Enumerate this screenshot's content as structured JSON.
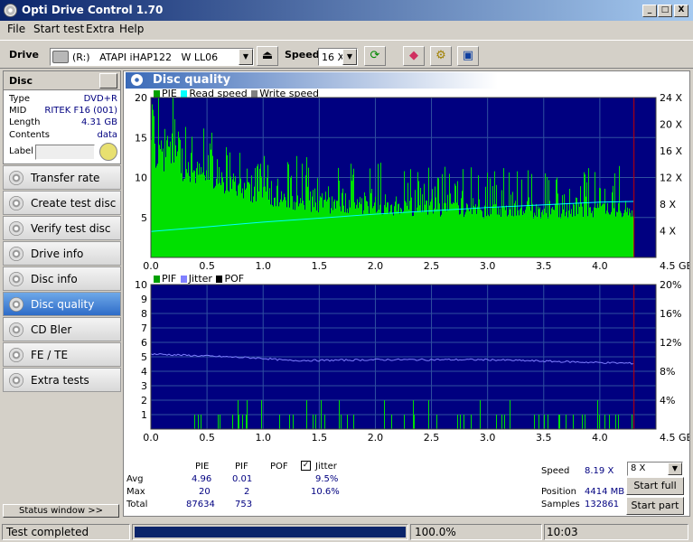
{
  "window": {
    "title": "Opti Drive Control 1.70",
    "btn_min": "_",
    "btn_max": "□",
    "btn_close": "X"
  },
  "menu": {
    "file": "File",
    "start_test": "Start test",
    "extra": "Extra",
    "help": "Help"
  },
  "toolbar": {
    "drive_label": "Drive",
    "drive_value": "(R:)   ATAPI iHAP122   W LL06",
    "speed_label": "Speed",
    "speed_value": "16 X"
  },
  "disc": {
    "header": "Disc",
    "type_k": "Type",
    "type_v": "DVD+R",
    "mid_k": "MID",
    "mid_v": "RITEK F16 (001)",
    "length_k": "Length",
    "length_v": "4.31 GB",
    "contents_k": "Contents",
    "contents_v": "data",
    "label_k": "Label",
    "label_v": ""
  },
  "nav": [
    {
      "label": "Transfer rate"
    },
    {
      "label": "Create test disc"
    },
    {
      "label": "Verify test disc"
    },
    {
      "label": "Drive info"
    },
    {
      "label": "Disc info"
    },
    {
      "label": "Disc quality"
    },
    {
      "label": "CD Bler"
    },
    {
      "label": "FE / TE"
    },
    {
      "label": "Extra tests"
    }
  ],
  "status_window": "Status window >>",
  "main": {
    "title": "Disc quality",
    "legend1": {
      "pie": "PIE",
      "read": "Read speed",
      "write": "Write speed"
    },
    "legend2": {
      "pif": "PIF",
      "jitter": "Jitter",
      "pof": "POF"
    }
  },
  "chart_data": [
    {
      "type": "bar",
      "title": "",
      "series": [
        {
          "name": "PIE",
          "color": "#00e000",
          "baseline_values": [
            15,
            11,
            8.5,
            7.4,
            7,
            6.8,
            6.5,
            6.5,
            6.5,
            6.5
          ],
          "x": [
            0.0,
            0.5,
            1.0,
            1.5,
            2.0,
            2.5,
            3.0,
            3.5,
            4.0,
            4.3
          ],
          "max": 20,
          "avg": 4.96
        },
        {
          "name": "Read speed",
          "color": "#00ffff",
          "x": [
            0.0,
            0.5,
            1.0,
            1.5,
            2.0,
            2.5,
            3.0,
            3.5,
            4.0,
            4.3
          ],
          "values": [
            3.9,
            4.6,
            5.3,
            5.9,
            6.5,
            7.0,
            7.5,
            7.9,
            8.3,
            8.4
          ]
        },
        {
          "name": "Write speed",
          "color": "#808080",
          "values": []
        }
      ],
      "x_ticks": [
        "0.0",
        "0.5",
        "1.0",
        "1.5",
        "2.0",
        "2.5",
        "3.0",
        "3.5",
        "4.0",
        "4.5 GB"
      ],
      "y_left_ticks": [
        "5",
        "10",
        "15",
        "20"
      ],
      "y_right_ticks": [
        "4 X",
        "8 X",
        "12 X",
        "16 X",
        "20 X",
        "24 X"
      ],
      "xlim": [
        0,
        4.5
      ],
      "ylim": [
        0,
        20
      ],
      "y2lim": [
        0,
        24
      ],
      "background": "#000080",
      "grid": true
    },
    {
      "type": "bar",
      "title": "",
      "series": [
        {
          "name": "PIF",
          "color": "#00e000",
          "max": 2,
          "avg": 0.01
        },
        {
          "name": "Jitter",
          "color": "#8080ff",
          "x": [
            0.0,
            0.5,
            1.0,
            1.2,
            1.5,
            2.0,
            2.5,
            3.0,
            3.5,
            4.0,
            4.3
          ],
          "values": [
            10.4,
            10.1,
            9.8,
            9.5,
            9.5,
            9.6,
            9.6,
            9.6,
            9.4,
            9.2,
            9.1
          ],
          "max": 10.6,
          "avg": 9.5
        },
        {
          "name": "POF",
          "color": "#000000",
          "values": []
        }
      ],
      "x_ticks": [
        "0.0",
        "0.5",
        "1.0",
        "1.5",
        "2.0",
        "2.5",
        "3.0",
        "3.5",
        "4.0",
        "4.5 GB"
      ],
      "y_left_ticks": [
        "1",
        "2",
        "3",
        "4",
        "5",
        "6",
        "7",
        "8",
        "9",
        "10"
      ],
      "y_right_ticks": [
        "4%",
        "8%",
        "12%",
        "16%",
        "20%"
      ],
      "xlim": [
        0,
        4.5
      ],
      "ylim": [
        0,
        10
      ],
      "y2lim": [
        0,
        20
      ],
      "background": "#000080",
      "grid": true
    }
  ],
  "stats": {
    "h_pie": "PIE",
    "h_pif": "PIF",
    "h_pof": "POF",
    "h_jitter": "Jitter",
    "avg_label": "Avg",
    "max_label": "Max",
    "total_label": "Total",
    "avg_pie": "4.96",
    "avg_pif": "0.01",
    "avg_jitter": "9.5%",
    "max_pie": "20",
    "max_pif": "2",
    "max_jitter": "10.6%",
    "total_pie": "87634",
    "total_pif": "753",
    "speed_label": "Speed",
    "speed_value": "8.19 X",
    "position_label": "Position",
    "position_value": "4414 MB",
    "samples_label": "Samples",
    "samples_value": "132861",
    "speed_select": "8 X",
    "start_full": "Start full",
    "start_part": "Start part"
  },
  "statusbar": {
    "status": "Test completed",
    "progress": "100.0%",
    "progress_fraction": 1.0,
    "time": "10:03"
  }
}
